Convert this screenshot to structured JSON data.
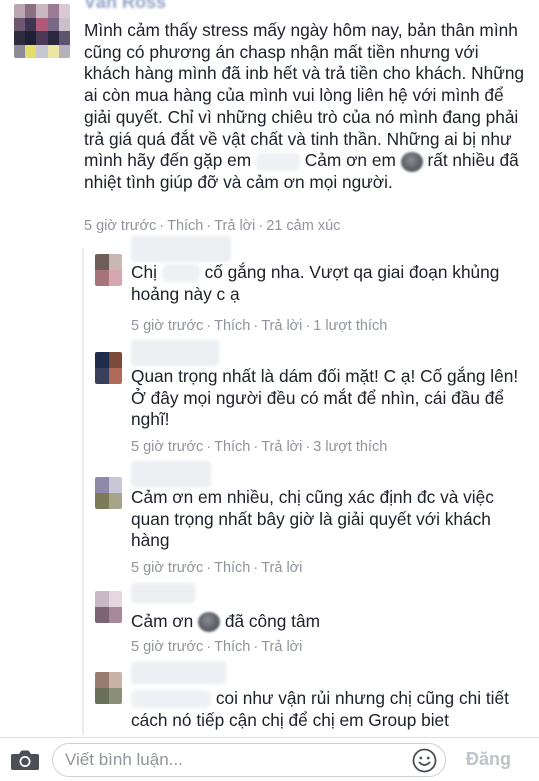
{
  "main_comment": {
    "author_name": "Vân Ross",
    "text": "Mình cảm thấy stress mấy ngày hôm nay, bản thân mình cũng có phương án chasp nhận mất tiền nhưng với khách hàng mình đã inb hết và trả tiền cho khách. Những ai còn mua hàng của mình vui lòng liên hệ với mình để giải quyết. Chỉ vì những chiêu trò của nó mình đang phải trả giá quá đắt về vật chất và tinh thần. Những ai bị như mình hãy đến gặp em",
    "text_mid": "Cảm ơn em",
    "text_end": "rất nhiều đã nhiệt tình giúp đỡ và cảm ơn mọi người.",
    "time": "5 giờ trước",
    "like": "Thích",
    "reply": "Trả lời",
    "reactions": "21 cảm xúc"
  },
  "replies": [
    {
      "text_a": "Chị",
      "text_b": "cố gắng nha. Vượt qa giai đoạn khủng hoảng này c ạ",
      "time": "5 giờ trước",
      "like": "Thích",
      "reply": "Trả lời",
      "likes_count": "1 lượt thích"
    },
    {
      "text": "Quan trọng nhất là dám đối mặt! C ạ! Cố gắng lên! Ở đây mọi người đều có mắt để nhìn, cái đầu để nghĩ!",
      "time": "5 giờ trước",
      "like": "Thích",
      "reply": "Trả lời",
      "likes_count": "3 lượt thích"
    },
    {
      "text": "Cảm ơn em nhiều, chị cũng xác định đc và việc quan trọng nhất bây giờ là giải quyết với khách hàng",
      "time": "5 giờ trước",
      "like": "Thích",
      "reply": "Trả lời"
    },
    {
      "text_a": "Cảm ơn",
      "text_b": "đã công tâm",
      "time": "5 giờ trước",
      "like": "Thích",
      "reply": "Trả lời"
    },
    {
      "text_a": "coi như vận rủi nhưng chị cũng chi tiết cách nó tiếp cận chị để chị em Group biet"
    }
  ],
  "composer": {
    "placeholder": "Viết bình luận...",
    "send_label": "Đăng",
    "camera_icon": "camera-icon",
    "emoji_icon": "smiley-icon"
  },
  "colors": {
    "text": "#1d2129",
    "meta": "#90949c",
    "send_disabled": "#bec3c9",
    "border": "#ccd0d5"
  }
}
